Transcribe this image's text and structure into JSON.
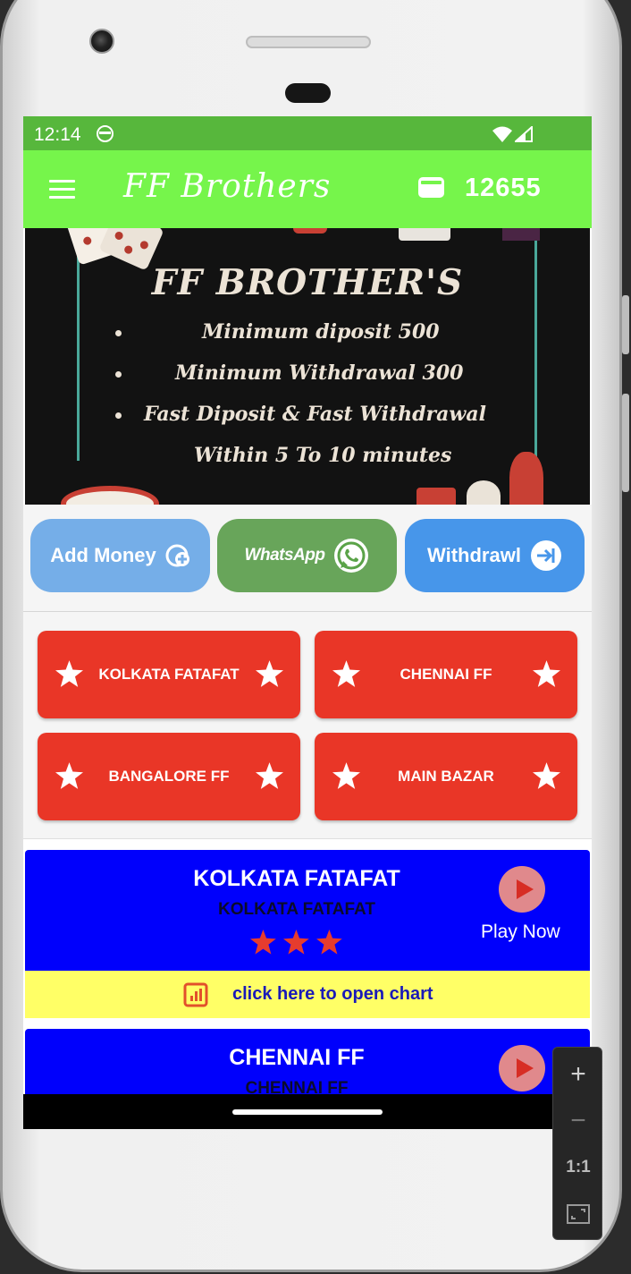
{
  "status_bar": {
    "time": "12:14"
  },
  "app_bar": {
    "title": "FF Brothers",
    "wallet_balance": "12655"
  },
  "banner": {
    "title": "FF BROTHER'S",
    "lines": [
      "Minimum diposit 500",
      "Minimum Withdrawal 300",
      "Fast Diposit & Fast Withdrawal",
      "Within 5 To 10 minutes"
    ]
  },
  "actions": {
    "add_money": "Add Money",
    "whatsapp": "WhatsApp",
    "withdrawl": "Withdrawl"
  },
  "markets": [
    "KOLKATA FATAFAT",
    "CHENNAI FF",
    "BANGALORE FF",
    "MAIN BAZAR"
  ],
  "games": [
    {
      "title": "KOLKATA FATAFAT",
      "subtitle": "KOLKATA FATAFAT",
      "play_label": "Play Now",
      "chart_label": "click here to open chart"
    },
    {
      "title": "CHENNAI FF",
      "subtitle": "CHENNAI FF"
    }
  ],
  "emulator_zoom": {
    "zoom_in": "+",
    "zoom_out": "−",
    "actual_size": "1:1"
  },
  "colors": {
    "status_bar": "#57b73c",
    "app_bar": "#76f54b",
    "tile_red": "#e93627",
    "card_blue": "#0000fc",
    "chart_yellow": "#ffff66"
  }
}
